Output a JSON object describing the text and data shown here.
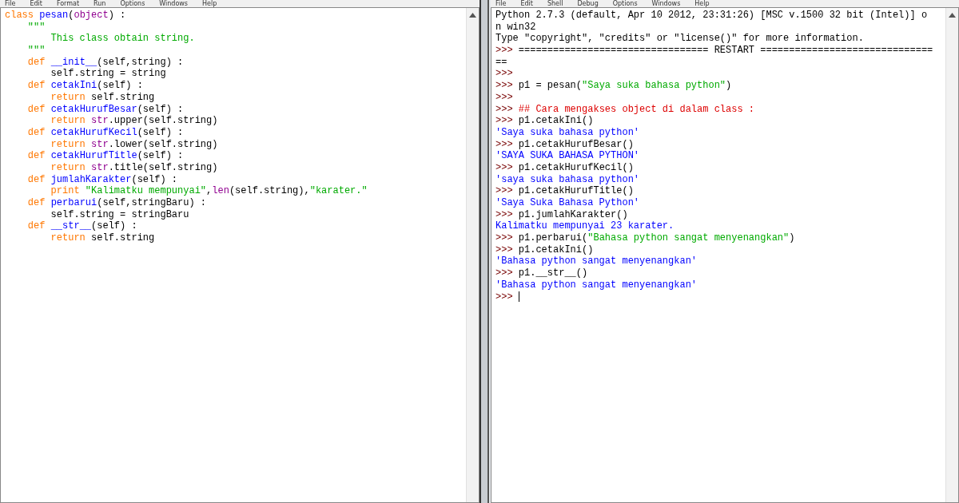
{
  "editor": {
    "menu": [
      "File",
      "Edit",
      "Format",
      "Run",
      "Options",
      "Windows",
      "Help"
    ],
    "lines": [
      [
        {
          "kind": "keyword",
          "text": "class "
        },
        {
          "kind": "name",
          "text": "pesan"
        },
        {
          "kind": "plain",
          "text": "("
        },
        {
          "kind": "builtin",
          "text": "object"
        },
        {
          "kind": "plain",
          "text": ") :"
        }
      ],
      [
        {
          "kind": "string",
          "text": "    \"\"\""
        }
      ],
      [
        {
          "kind": "string",
          "text": "        This class obtain string."
        }
      ],
      [
        {
          "kind": "string",
          "text": "    \"\"\""
        }
      ],
      [
        {
          "kind": "keyword",
          "text": "    def "
        },
        {
          "kind": "name",
          "text": "__init__"
        },
        {
          "kind": "plain",
          "text": "(self,string) :"
        }
      ],
      [
        {
          "kind": "plain",
          "text": "        self.string = string"
        }
      ],
      [
        {
          "kind": "keyword",
          "text": "    def "
        },
        {
          "kind": "name",
          "text": "cetakIni"
        },
        {
          "kind": "plain",
          "text": "(self) :"
        }
      ],
      [
        {
          "kind": "keyword",
          "text": "        return "
        },
        {
          "kind": "plain",
          "text": "self.string"
        }
      ],
      [
        {
          "kind": "keyword",
          "text": "    def "
        },
        {
          "kind": "name",
          "text": "cetakHurufBesar"
        },
        {
          "kind": "plain",
          "text": "(self) :"
        }
      ],
      [
        {
          "kind": "keyword",
          "text": "        return "
        },
        {
          "kind": "builtin",
          "text": "str"
        },
        {
          "kind": "plain",
          "text": ".upper(self.string)"
        }
      ],
      [
        {
          "kind": "keyword",
          "text": "    def "
        },
        {
          "kind": "name",
          "text": "cetakHurufKecil"
        },
        {
          "kind": "plain",
          "text": "(self) :"
        }
      ],
      [
        {
          "kind": "keyword",
          "text": "        return "
        },
        {
          "kind": "builtin",
          "text": "str"
        },
        {
          "kind": "plain",
          "text": ".lower(self.string)"
        }
      ],
      [
        {
          "kind": "keyword",
          "text": "    def "
        },
        {
          "kind": "name",
          "text": "cetakHurufTitle"
        },
        {
          "kind": "plain",
          "text": "(self) :"
        }
      ],
      [
        {
          "kind": "keyword",
          "text": "        return "
        },
        {
          "kind": "builtin",
          "text": "str"
        },
        {
          "kind": "plain",
          "text": ".title(self.string)"
        }
      ],
      [
        {
          "kind": "keyword",
          "text": "    def "
        },
        {
          "kind": "name",
          "text": "jumlahKarakter"
        },
        {
          "kind": "plain",
          "text": "(self) :"
        }
      ],
      [
        {
          "kind": "keyword",
          "text": "        print "
        },
        {
          "kind": "string",
          "text": "\"Kalimatku mempunyai\""
        },
        {
          "kind": "plain",
          "text": ","
        },
        {
          "kind": "builtin",
          "text": "len"
        },
        {
          "kind": "plain",
          "text": "(self.string),"
        },
        {
          "kind": "string",
          "text": "\"karater.\""
        }
      ],
      [
        {
          "kind": "keyword",
          "text": "    def "
        },
        {
          "kind": "name",
          "text": "perbarui"
        },
        {
          "kind": "plain",
          "text": "(self,stringBaru) :"
        }
      ],
      [
        {
          "kind": "plain",
          "text": "        self.string = stringBaru"
        }
      ],
      [
        {
          "kind": "keyword",
          "text": "    def "
        },
        {
          "kind": "name",
          "text": "__str__"
        },
        {
          "kind": "plain",
          "text": "(self) :"
        }
      ],
      [
        {
          "kind": "keyword",
          "text": "        return "
        },
        {
          "kind": "plain",
          "text": "self.string"
        }
      ]
    ]
  },
  "shell": {
    "menu": [
      "File",
      "Edit",
      "Shell",
      "Debug",
      "Options",
      "Windows",
      "Help"
    ],
    "lines": [
      [
        {
          "kind": "plain",
          "text": "Python 2.7.3 (default, Apr 10 2012, 23:31:26) [MSC v.1500 32 bit (Intel)] o"
        }
      ],
      [
        {
          "kind": "plain",
          "text": "n win32"
        }
      ],
      [
        {
          "kind": "plain",
          "text": "Type \"copyright\", \"credits\" or \"license()\" for more information."
        }
      ],
      [
        {
          "kind": "prompt",
          "text": ">>> "
        },
        {
          "kind": "plain",
          "text": "================================= RESTART =============================="
        }
      ],
      [
        {
          "kind": "plain",
          "text": "=="
        }
      ],
      [
        {
          "kind": "prompt",
          "text": ">>>"
        }
      ],
      [
        {
          "kind": "prompt",
          "text": ">>> "
        },
        {
          "kind": "plain",
          "text": "p1 = pesan("
        },
        {
          "kind": "string",
          "text": "\"Saya suka bahasa python\""
        },
        {
          "kind": "plain",
          "text": ")"
        }
      ],
      [
        {
          "kind": "prompt",
          "text": ">>>"
        }
      ],
      [
        {
          "kind": "prompt",
          "text": ">>> "
        },
        {
          "kind": "comment",
          "text": "## Cara mengakses object di dalam class :"
        }
      ],
      [
        {
          "kind": "prompt",
          "text": ">>> "
        },
        {
          "kind": "plain",
          "text": "p1.cetakIni()"
        }
      ],
      [
        {
          "kind": "output",
          "text": "'Saya suka bahasa python'"
        }
      ],
      [
        {
          "kind": "prompt",
          "text": ">>> "
        },
        {
          "kind": "plain",
          "text": "p1.cetakHurufBesar()"
        }
      ],
      [
        {
          "kind": "output",
          "text": "'SAYA SUKA BAHASA PYTHON'"
        }
      ],
      [
        {
          "kind": "prompt",
          "text": ">>> "
        },
        {
          "kind": "plain",
          "text": "p1.cetakHurufKecil()"
        }
      ],
      [
        {
          "kind": "output",
          "text": "'saya suka bahasa python'"
        }
      ],
      [
        {
          "kind": "prompt",
          "text": ">>> "
        },
        {
          "kind": "plain",
          "text": "p1.cetakHurufTitle()"
        }
      ],
      [
        {
          "kind": "output",
          "text": "'Saya Suka Bahasa Python'"
        }
      ],
      [
        {
          "kind": "prompt",
          "text": ">>> "
        },
        {
          "kind": "plain",
          "text": "p1.jumlahKarakter()"
        }
      ],
      [
        {
          "kind": "output",
          "text": "Kalimatku mempunyai 23 karater."
        }
      ],
      [
        {
          "kind": "prompt",
          "text": ">>> "
        },
        {
          "kind": "plain",
          "text": "p1.perbarui("
        },
        {
          "kind": "string",
          "text": "\"Bahasa python sangat menyenangkan\""
        },
        {
          "kind": "plain",
          "text": ")"
        }
      ],
      [
        {
          "kind": "prompt",
          "text": ">>> "
        },
        {
          "kind": "plain",
          "text": "p1.cetakIni()"
        }
      ],
      [
        {
          "kind": "output",
          "text": "'Bahasa python sangat menyenangkan'"
        }
      ],
      [
        {
          "kind": "prompt",
          "text": ">>> "
        },
        {
          "kind": "plain",
          "text": "p1.__str__()"
        }
      ],
      [
        {
          "kind": "output",
          "text": "'Bahasa python sangat menyenangkan'"
        }
      ],
      [
        {
          "kind": "prompt",
          "text": ">>> "
        },
        {
          "kind": "cursor"
        }
      ]
    ]
  }
}
